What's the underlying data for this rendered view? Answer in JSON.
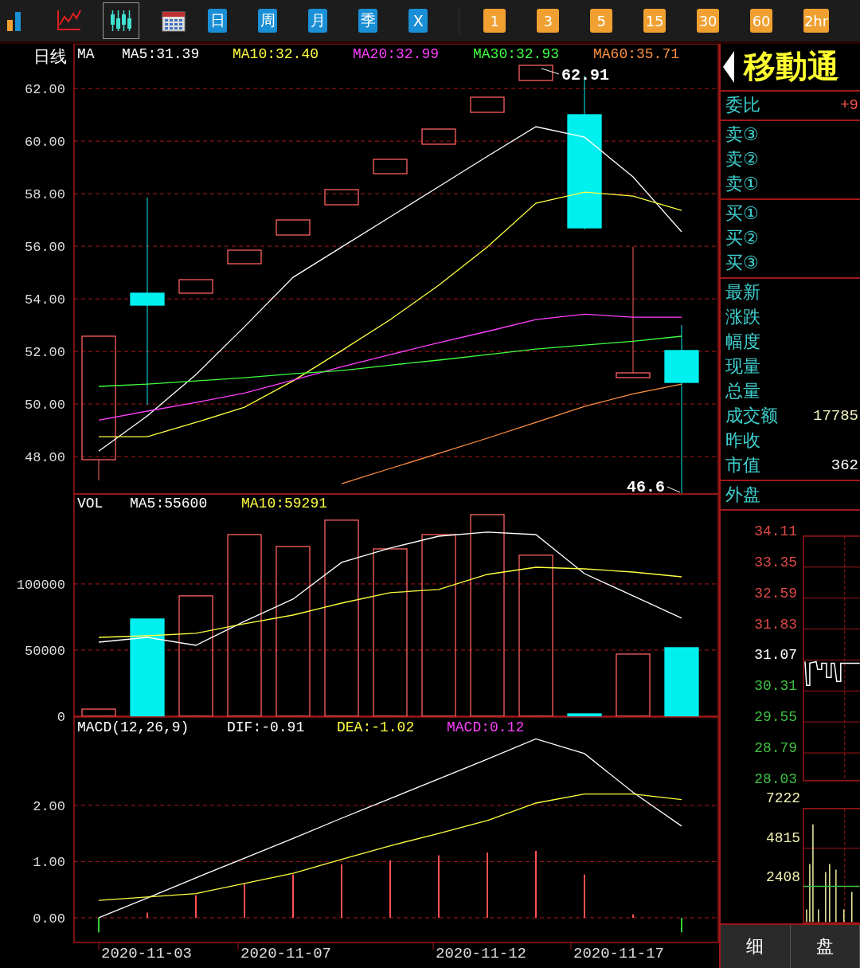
{
  "toolbar": {
    "icons": [
      {
        "kind": "bars",
        "selected": false
      },
      {
        "kind": "line",
        "selected": false
      },
      {
        "kind": "candles",
        "selected": true
      },
      {
        "kind": "calendar",
        "selected": false
      }
    ],
    "periods": [
      {
        "label": "日",
        "kind": "blue"
      },
      {
        "label": "周",
        "kind": "blue"
      },
      {
        "label": "月",
        "kind": "blue"
      },
      {
        "label": "季",
        "kind": "blue"
      },
      {
        "label": "X",
        "kind": "blue"
      },
      {
        "label": "1",
        "kind": "orange"
      },
      {
        "label": "3",
        "kind": "orange"
      },
      {
        "label": "5",
        "kind": "orange"
      },
      {
        "label": "15",
        "kind": "orange"
      },
      {
        "label": "30",
        "kind": "orange"
      },
      {
        "label": "60",
        "kind": "orange"
      },
      {
        "label": "2hr",
        "kind": "orange"
      }
    ]
  },
  "chart": {
    "period_label": "日线",
    "price_panel": {
      "legend_title": "MA",
      "high_label": "62.91",
      "low_label": "46.6",
      "chart_data": {
        "type": "line",
        "grid": true,
        "ylim": [
          46.58,
          63.7
        ],
        "yticks": [
          {
            "value": 62,
            "label": "62.00"
          },
          {
            "value": 60,
            "label": "60.00"
          },
          {
            "value": 58,
            "label": "58.00"
          },
          {
            "value": 56,
            "label": "56.00"
          },
          {
            "value": 54,
            "label": "54.00"
          },
          {
            "value": 52,
            "label": "52.00"
          },
          {
            "value": 50,
            "label": "50.00"
          },
          {
            "value": 48,
            "label": "48.00"
          }
        ],
        "series": [
          {
            "name": "MA5:31.39",
            "color": "#ffffff",
            "values": [
              48.21,
              49.55,
              51.12,
              52.94,
              54.82,
              55.97,
              57.12,
              58.27,
              59.42,
              60.55,
              60.15,
              58.64,
              56.55
            ]
          },
          {
            "name": "MA10:32.40",
            "color": "#ffff40",
            "values": [
              48.76,
              48.76,
              49.3,
              49.88,
              50.88,
              52.03,
              53.21,
              54.52,
              55.97,
              57.64,
              58.06,
              57.91,
              57.36
            ]
          },
          {
            "name": "MA20:32.99",
            "color": "#ff40ff",
            "values": [
              49.39,
              49.73,
              50.06,
              50.42,
              50.91,
              51.42,
              51.88,
              52.33,
              52.76,
              53.21,
              53.42,
              53.3,
              53.3
            ]
          },
          {
            "name": "MA30:32.93",
            "color": "#40ff40",
            "values": [
              50.67,
              50.76,
              50.88,
              51.0,
              51.15,
              51.27,
              51.48,
              51.67,
              51.88,
              52.09,
              52.24,
              52.39,
              52.58
            ]
          },
          {
            "name": "MA60:35.71",
            "color": "#ff9040",
            "values": [
              null,
              null,
              null,
              null,
              null,
              46.97,
              47.55,
              48.12,
              48.7,
              49.3,
              49.91,
              50.39,
              50.76
            ]
          }
        ]
      }
    },
    "volume_panel": {
      "legend_title": "VOL",
      "chart_data": {
        "type": "bar",
        "grid": true,
        "ylim": [
          0,
          168000
        ],
        "yticks": [
          {
            "value": 100000,
            "label": "100000"
          },
          {
            "value": 50000,
            "label": "50000"
          },
          {
            "value": 0,
            "label": "0"
          }
        ],
        "series": [
          {
            "colors": [
              "#ff6060",
              "#00f0f0",
              "#ff6060",
              "#ff6060",
              "#ff6060",
              "#ff6060",
              "#ff6060",
              "#ff6060",
              "#ff6060",
              "#ff6060",
              "#00f0f0",
              "#ff6060",
              "#00f0f0"
            ],
            "values": [
              5400,
              73500,
              91000,
              137300,
              128300,
              148200,
              126500,
              137300,
              152400,
              121700,
              1800,
              47000,
              51800
            ]
          },
          {
            "name": "MA5:55600",
            "type": "line",
            "color": "#ffffff",
            "values": [
              56000,
              59600,
              53600,
              71700,
              88600,
              116300,
              127100,
              136100,
              139200,
              137300,
              107800,
              91000,
              74100
            ]
          },
          {
            "name": "MA10:59291",
            "type": "line",
            "color": "#ffff40",
            "values": [
              59600,
              60800,
              62700,
              69900,
              76500,
              85500,
              93400,
              95800,
              107200,
              112600,
              111400,
              109000,
              105400
            ]
          }
        ]
      }
    },
    "macd_panel": {
      "legend_title": "MACD(12,26,9)",
      "legend_note": {
        "label": "MACD:0.12",
        "color": "#ff40ff"
      },
      "chart_data": {
        "type": "bar",
        "grid": true,
        "ylim": [
          -0.44,
          3.57
        ],
        "yticks": [
          {
            "value": 2,
            "label": "2.00"
          },
          {
            "value": 1,
            "label": "1.00"
          },
          {
            "value": 0,
            "label": "0.00"
          }
        ],
        "series": [
          {
            "name": "DIF:-0.91",
            "type": "line",
            "color": "#ffffff",
            "values": [
              0,
              0.35,
              0.71,
              1.06,
              1.41,
              1.77,
              2.12,
              2.47,
              2.82,
              3.18,
              2.92,
              2.23,
              1.63
            ]
          },
          {
            "name": "DEA:-1.02",
            "type": "line",
            "color": "#ffff40",
            "values": [
              0.31,
              0.37,
              0.43,
              0.61,
              0.79,
              1.04,
              1.28,
              1.5,
              1.73,
              2.04,
              2.2,
              2.2,
              2.1
            ]
          },
          {
            "colors": [
              "#30d030",
              "#ff5050",
              "#ff5050",
              "#ff5050",
              "#ff5050",
              "#ff5050",
              "#ff5050",
              "#ff5050",
              "#ff5050",
              "#ff5050",
              "#ff5050",
              "#ff5050",
              "#30d030"
            ],
            "values": [
              -0.26,
              0.09,
              0.4,
              0.6,
              0.77,
              0.95,
              1.02,
              1.11,
              1.16,
              1.19,
              0.77,
              0.06,
              -0.26
            ]
          }
        ]
      }
    },
    "dates": [
      "2020-11-03",
      "2020-11-07",
      "2020-11-12",
      "2020-11-17"
    ]
  },
  "quote_panel": {
    "title": "移動通",
    "ratio": {
      "label": "委比",
      "value": "+9"
    },
    "sell": [
      "卖③",
      "卖②",
      "卖①"
    ],
    "buy": [
      "买①",
      "买②",
      "买③"
    ],
    "fields": [
      {
        "label": "最新"
      },
      {
        "label": "涨跌"
      },
      {
        "label": "幅度"
      },
      {
        "label": "现量"
      },
      {
        "label": "总量"
      },
      {
        "label": "成交额",
        "value": "17785"
      },
      {
        "label": "昨收"
      },
      {
        "label": "市值",
        "value": "362"
      }
    ],
    "outer_label": "外盘",
    "price_ticks": [
      {
        "label": "34.11",
        "color": "#e04848"
      },
      {
        "label": "33.35",
        "color": "#e04848"
      },
      {
        "label": "32.59",
        "color": "#e04848"
      },
      {
        "label": "31.83",
        "color": "#e04848"
      },
      {
        "label": "31.07",
        "color": "#ffffff"
      },
      {
        "label": "30.31",
        "color": "#40c040"
      },
      {
        "label": "29.55",
        "color": "#40c040"
      },
      {
        "label": "28.79",
        "color": "#40c040"
      },
      {
        "label": "28.03",
        "color": "#40c040"
      }
    ],
    "volume_ticks": [
      "7222",
      "4815",
      "2408"
    ],
    "tabs": [
      "细",
      "盘"
    ]
  }
}
